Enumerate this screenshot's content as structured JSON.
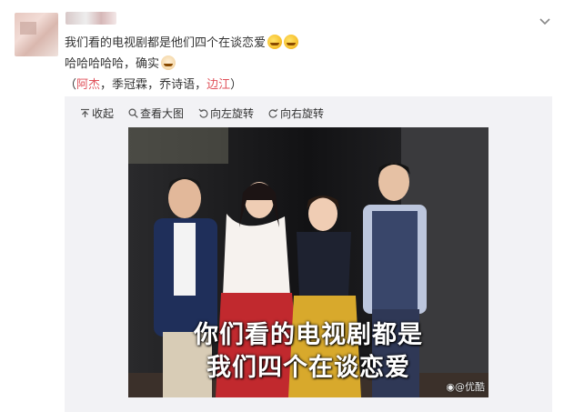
{
  "post": {
    "text_line1": "我们看的电视剧都是他们四个在谈恋爱",
    "text_line2": "哈哈哈哈哈，确实",
    "mentions_open": "（",
    "mention1": "阿杰",
    "sep1": "，",
    "mention2": "季冠霖",
    "sep2": "，",
    "mention3": "乔诗语",
    "sep3": "，",
    "mention4": "边江",
    "mentions_close": "）"
  },
  "toolbar": {
    "collapse": "收起",
    "view_large": "查看大图",
    "rotate_left": "向左旋转",
    "rotate_right": "向右旋转"
  },
  "photo": {
    "caption_line1": "你们看的电视剧都是",
    "caption_line2": "我们四个在谈恋爱",
    "watermark": "@优酷"
  },
  "icons": [
    "chevron-down-icon",
    "collapse-icon",
    "magnifier-icon",
    "rotate-left-icon",
    "rotate-right-icon",
    "emoji-icon",
    "weibo-logo-icon"
  ],
  "colors": {
    "mention_red": "#e0515a",
    "media_bg": "#f2f2f5"
  }
}
